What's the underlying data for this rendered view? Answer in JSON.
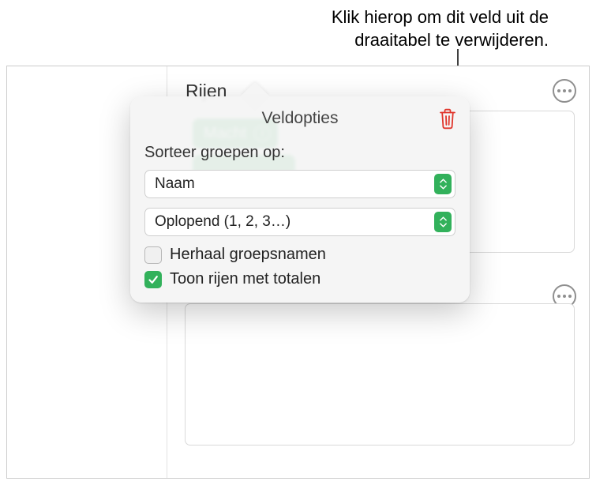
{
  "callout": {
    "line1": "Klik hierop om dit veld uit de",
    "line2": "draaitabel te verwijderen."
  },
  "section": {
    "title": "Rijen"
  },
  "field": {
    "label": "Macht"
  },
  "popover": {
    "title": "Veldopties",
    "sort_label": "Sorteer groepen op:",
    "sort_by": "Naam",
    "sort_order": "Oplopend (1, 2, 3…)",
    "repeat_label": "Herhaal groepsnamen",
    "totals_label": "Toon rijen met totalen"
  },
  "icons": {
    "trash": "trash-icon",
    "more": "more-icon",
    "info": "info-icon",
    "stepper": "up-down-icon",
    "check": "checkmark-icon"
  }
}
